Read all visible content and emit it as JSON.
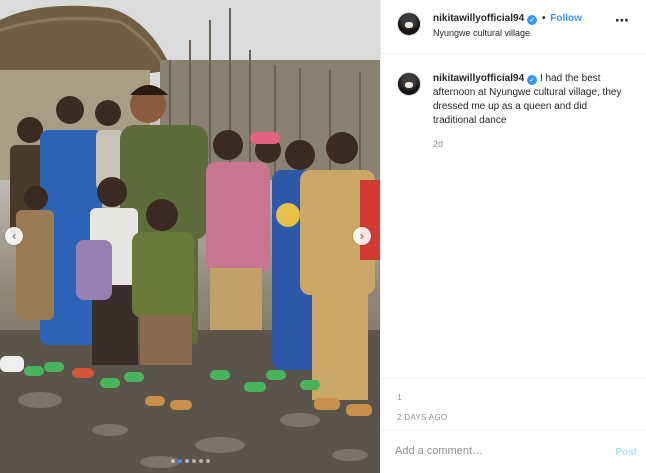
{
  "post": {
    "username": "nikitawillyofficial94",
    "follow_label": "Follow",
    "separator": "•",
    "location": "Nyungwe cultural village",
    "more_icon": "more-horizontal-icon",
    "caption": "I had the best afternoon at Nyungwe cultural village, they dressed me up as a queen and did traditional dance",
    "caption_time": "2d",
    "likes_text": "1",
    "post_date": "2 DAYS AGO"
  },
  "comment": {
    "placeholder": "Add a comment…",
    "post_label": "Post"
  },
  "carousel": {
    "prev_icon": "‹",
    "next_icon": "›",
    "slide_count": 6,
    "active_index": 1
  },
  "colors": {
    "accent": "#3897f0",
    "post_disabled": "#b2dffc"
  }
}
